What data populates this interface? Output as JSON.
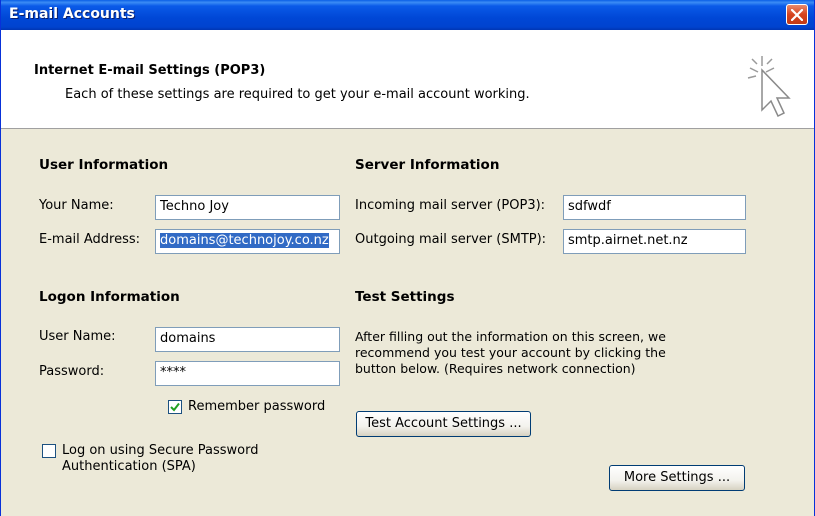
{
  "window": {
    "title": "E-mail Accounts"
  },
  "header": {
    "title": "Internet E-mail Settings (POP3)",
    "subtitle": "Each of these settings are required to get your e-mail account working."
  },
  "user_info": {
    "heading": "User Information",
    "name_label": "Your Name:",
    "name_value": "Techno Joy",
    "email_label": "E-mail Address:",
    "email_value": "domains@technojoy.co.nz"
  },
  "server_info": {
    "heading": "Server Information",
    "incoming_label": "Incoming mail server (POP3):",
    "incoming_value": "sdfwdf",
    "outgoing_label": "Outgoing mail server (SMTP):",
    "outgoing_value": "smtp.airnet.net.nz"
  },
  "logon_info": {
    "heading": "Logon Information",
    "username_label": "User Name:",
    "username_value": "domains",
    "password_label": "Password:",
    "password_value": "****",
    "remember_label": "Remember password",
    "remember_checked": true,
    "spa_label_line1": "Log on using Secure Password",
    "spa_label_line2": "Authentication (SPA)",
    "spa_checked": false
  },
  "test_settings": {
    "heading": "Test Settings",
    "description_line1": "After filling out the information on this screen, we",
    "description_line2": "recommend you test your account by clicking the",
    "description_line3": "button below. (Requires network connection)",
    "test_button": "Test Account Settings ...",
    "more_button": "More Settings ..."
  },
  "icons": {
    "close": "close-icon",
    "header": "cursor-sparkle-icon",
    "check": "check-icon"
  }
}
